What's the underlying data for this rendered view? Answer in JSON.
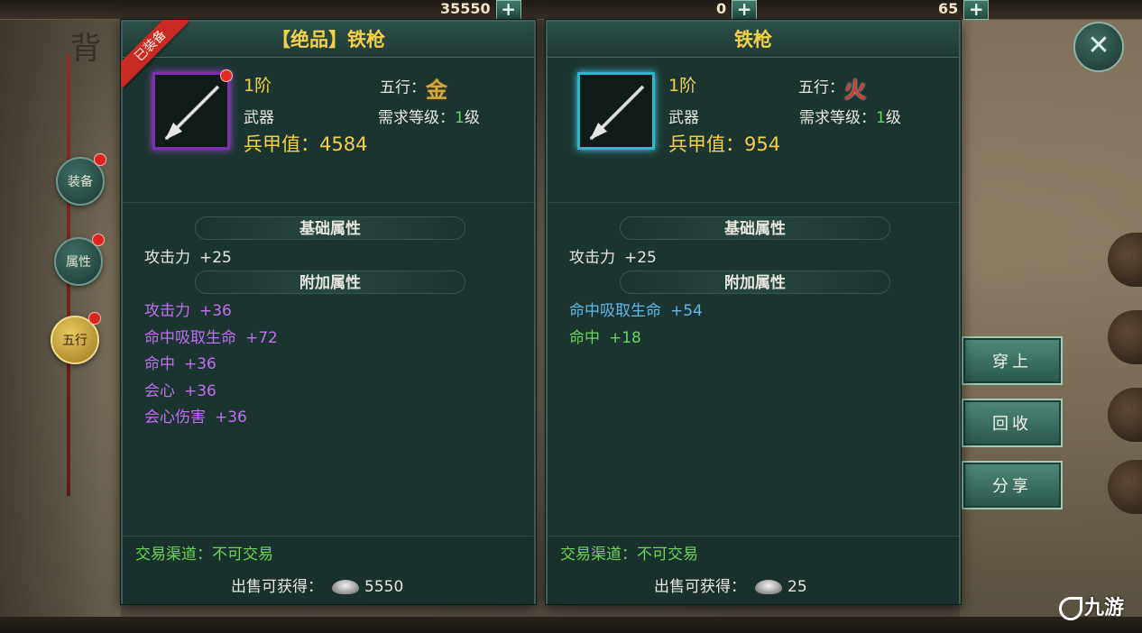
{
  "top_resources": [
    {
      "value": "35550"
    },
    {
      "value": "0"
    },
    {
      "value": "65"
    }
  ],
  "side_nav": [
    {
      "label": "装备"
    },
    {
      "label": "属性"
    },
    {
      "label": "五行"
    }
  ],
  "left_item": {
    "equipped_badge": "已装备",
    "title": "【绝品】铁枪",
    "tier": "1阶",
    "type": "武器",
    "wuxing_label": "五行：",
    "wuxing_glyph": "金",
    "req_label": "需求等级：",
    "req_level": "1",
    "req_unit": "级",
    "power": "兵甲值：4584",
    "base_section": "基础属性",
    "base_attrs": [
      {
        "name": "攻击力",
        "value": "+25"
      }
    ],
    "extra_section": "附加属性",
    "extra_attrs": [
      {
        "name": "攻击力",
        "value": "+36"
      },
      {
        "name": "命中吸取生命",
        "value": "+72"
      },
      {
        "name": "命中",
        "value": "+36"
      },
      {
        "name": "会心",
        "value": "+36"
      },
      {
        "name": "会心伤害",
        "value": "+36"
      }
    ],
    "trade": "交易渠道：不可交易",
    "sell_label": "出售可获得：",
    "sell_value": "5550",
    "rarity_color": "#c06ef2"
  },
  "right_item": {
    "title": "铁枪",
    "tier": "1阶",
    "type": "武器",
    "wuxing_label": "五行：",
    "wuxing_glyph": "火",
    "req_label": "需求等级：",
    "req_level": "1",
    "req_unit": "级",
    "power": "兵甲值：954",
    "base_section": "基础属性",
    "base_attrs": [
      {
        "name": "攻击力",
        "value": "+25"
      }
    ],
    "extra_section": "附加属性",
    "extra_attrs": [
      {
        "name": "命中吸取生命",
        "value": "+54"
      },
      {
        "name": "命中",
        "value": "+18"
      }
    ],
    "trade": "交易渠道：不可交易",
    "sell_label": "出售可获得：",
    "sell_value": "25",
    "rarity_color": "#2bb8cc"
  },
  "actions": {
    "equip": "穿上",
    "recycle": "回收",
    "share": "分享",
    "close": "✕"
  },
  "watermark": "九游"
}
